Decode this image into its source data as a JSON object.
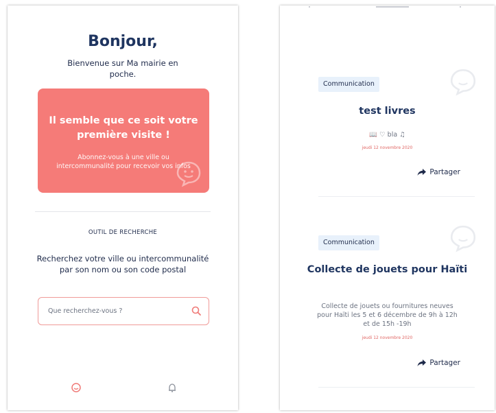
{
  "left_screen": {
    "greeting": "Bonjour,",
    "welcome_text": "Bienvenue sur Ma mairie en poche.",
    "first_visit_card": {
      "title": "Il semble que ce soit votre première visite !",
      "text": "Abonnez-vous à une ville ou intercommunalité pour recevoir vos infos",
      "background_color": "#f57b78"
    },
    "search_tool": {
      "section_title": "OUTIL DE RECHERCHE",
      "description": "Recherchez votre ville ou intercommunalité par son nom ou son code postal",
      "placeholder": "Que recherchez-vous ?",
      "icon": "search-icon"
    },
    "bottom_nav": {
      "items": [
        {
          "icon": "home-bubble-icon",
          "active": true
        },
        {
          "icon": "bell-icon",
          "active": false
        }
      ]
    }
  },
  "right_screen": {
    "posts": [
      {
        "category": "Communication",
        "title": "test livres",
        "description": "📖 ♡ bla ♫",
        "date": "jeudi 12 novembre 2020",
        "share_label": "Partager"
      },
      {
        "category": "Communication",
        "title": "Collecte de jouets pour Haïti",
        "description": "Collecte de jouets ou fournitures neuves pour Haïti les 5 et 6 décembre de 9h à 12h et de 15h -19h",
        "date": "jeudi 12 novembre 2020",
        "share_label": "Partager"
      }
    ]
  },
  "colors": {
    "accent": "#f57b78",
    "heading": "#1f3560",
    "badge_bg": "#e8f1fb",
    "date": "#e06663"
  }
}
